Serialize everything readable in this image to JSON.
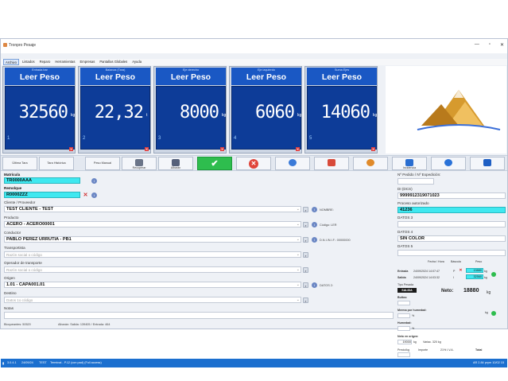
{
  "window": {
    "title": "Tronpro Pesaje"
  },
  "menu": [
    "Archivo",
    "Listados",
    "Reparo",
    "Herramientas",
    "Empresas",
    "Pantallas Globales",
    "Ayuda"
  ],
  "scales": [
    {
      "name": "Entrada bar",
      "button": "Leer Peso",
      "value": "32560",
      "unit": "kg",
      "num": "1"
    },
    {
      "name": "Balanza (Tara)",
      "button": "Leer Peso",
      "value": "22,32",
      "unit": "t",
      "num": "2"
    },
    {
      "name": "Eje derecho",
      "button": "Leer Peso",
      "value": "8000",
      "unit": "kg",
      "num": "3"
    },
    {
      "name": "Eje izquierdo",
      "button": "Leer Peso",
      "value": "6060",
      "unit": "kg",
      "num": "4"
    },
    {
      "name": "Suma Ejes",
      "button": "Leer Peso",
      "value": "14060",
      "unit": "kg",
      "num": "5"
    }
  ],
  "toolbar": {
    "ultima_tara": "Última Tara",
    "tara_historica": "Tara Histórica",
    "peso_manual": "Peso Manual",
    "recuperar": "Recuperar",
    "albaran": "Albarán",
    "incidencia": "Incidencia"
  },
  "form": {
    "matricula": {
      "label": "Matrícula",
      "value": "TR0000AAA"
    },
    "remolque": {
      "label": "Remolque",
      "value": "R0000ZZZ"
    },
    "cliente": {
      "label": "Cliente / Proveedor",
      "value": "TEST CLIENTE - TEST",
      "note": "NOMBRE:"
    },
    "producto": {
      "label": "Producto",
      "value": "ACERO - ACERO00001",
      "note": "Código: LER"
    },
    "conductor": {
      "label": "Conductor",
      "value": "PABLO PEREZ URRUTIA - PB1",
      "note": "D.N.I./N.I.F.: 00000000"
    },
    "transportista": {
      "label": "Transportista",
      "placeholder": "Razón social o código"
    },
    "operador": {
      "label": "Operador de transporte",
      "placeholder": "Razón social o código"
    },
    "origen": {
      "label": "Origen",
      "value": "1.01 - CAPA001.01",
      "note": "DATOS 2:"
    },
    "destino": {
      "label": "Destino",
      "placeholder": "Datos 1o código"
    },
    "notas": {
      "label": "Notas"
    },
    "footer_left": "Bloqueantes: 50520",
    "footer_right": "Albarán: Salida: 139405 / Entrada: 464"
  },
  "right": {
    "pedido": {
      "label": "Nº Pedido / Nº Expedición:",
      "value": ""
    },
    "di": {
      "label": "DI (DCS)",
      "value": "9999912319071023"
    },
    "proceso": {
      "label": "Proceso autorizado",
      "value": "41236"
    },
    "datos3": {
      "label": "DATOS 3",
      "value": ""
    },
    "datos4": {
      "label": "DATOS 4",
      "value": "SIN COLOR"
    },
    "datos5": {
      "label": "DATOS 5",
      "value": ""
    },
    "headers": {
      "fecha": "Fecha / Hora",
      "bascula": "Báscula",
      "peso": "Peso"
    },
    "entrada": {
      "label": "Entrada",
      "fecha": "24/09/2024 14:07:47",
      "bascula": "P",
      "peso": "13880"
    },
    "salida": {
      "label": "Salida",
      "fecha": "24/09/2024 14:03:32",
      "bascula": "I",
      "peso": "32560"
    },
    "tipo_pesada_label": "Tipo Pesada",
    "tipo_pesada_value": "SALIDA",
    "neto_label": "Neto:",
    "neto_value": "18880",
    "neto_unit": "kg",
    "bultos_label": "Bultos:",
    "merma_label": "Merma por humedad:",
    "merma_unit": "%",
    "merma_kg": "kg",
    "humedad_label": "Humedad:",
    "humedad_unit": "%",
    "neto_origen_label": "Neto en origen:",
    "neto_origen_value": "19000",
    "neto_origen_unit": "kg",
    "variacion": "Variac. 320 kg",
    "precio_label": "Precio/kg",
    "importe_label": "Importe",
    "iva_label": "21% I.V.A.",
    "total_label": "Total"
  },
  "status": {
    "version": "3.0.4.1",
    "date": "24/09/24",
    "user": "TEST",
    "device": "Terminal - P.12 (con pad) (Full access)",
    "right": "AR 2.84 prym 10/02 15"
  }
}
